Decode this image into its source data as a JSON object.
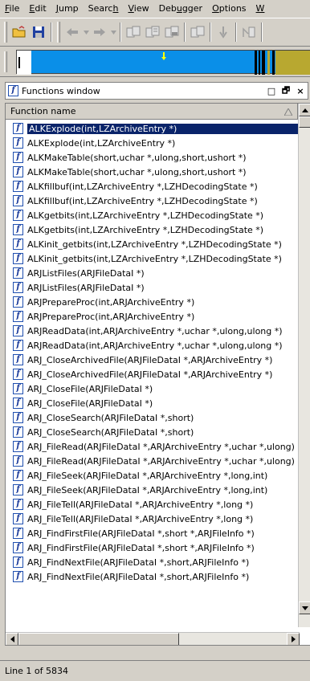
{
  "menu": [
    {
      "label": "File",
      "u": "F",
      "rest": "ile"
    },
    {
      "label": "Edit",
      "u": "E",
      "rest": "dit"
    },
    {
      "label": "Jump",
      "u": "J",
      "rest": "ump"
    },
    {
      "label": "Search",
      "pre": "Searc",
      "u": "h",
      "rest": ""
    },
    {
      "label": "View",
      "u": "V",
      "rest": "iew"
    },
    {
      "label": "Debugger",
      "pre": "Deb",
      "u": "u",
      "rest": "gger"
    },
    {
      "label": "Options",
      "u": "O",
      "rest": "ptions"
    },
    {
      "label": "W",
      "u": "W",
      "rest": ""
    }
  ],
  "panel": {
    "title": "Functions window",
    "icon": "f",
    "buttons": [
      "□",
      "🗗",
      "×"
    ]
  },
  "list": {
    "column_header": "Function name",
    "selected_index": 0,
    "items": [
      "ALKExplode(int,LZArchiveEntry *)",
      "ALKExplode(int,LZArchiveEntry *)",
      "ALKMakeTable(short,uchar *,ulong,short,ushort *)",
      "ALKMakeTable(short,uchar *,ulong,short,ushort *)",
      "ALKfillbuf(int,LZArchiveEntry *,LZHDecodingState *)",
      "ALKfillbuf(int,LZArchiveEntry *,LZHDecodingState *)",
      "ALKgetbits(int,LZArchiveEntry *,LZHDecodingState *)",
      "ALKgetbits(int,LZArchiveEntry *,LZHDecodingState *)",
      "ALKinit_getbits(int,LZArchiveEntry *,LZHDecodingState *)",
      "ALKinit_getbits(int,LZArchiveEntry *,LZHDecodingState *)",
      "ARJListFiles(ARJFileDataI *)",
      "ARJListFiles(ARJFileDataI *)",
      "ARJPrepareProc(int,ARJArchiveEntry *)",
      "ARJPrepareProc(int,ARJArchiveEntry *)",
      "ARJReadData(int,ARJArchiveEntry *,uchar *,ulong,ulong *)",
      "ARJReadData(int,ARJArchiveEntry *,uchar *,ulong,ulong *)",
      "ARJ_CloseArchivedFile(ARJFileDataI *,ARJArchiveEntry *)",
      "ARJ_CloseArchivedFile(ARJFileDataI *,ARJArchiveEntry *)",
      "ARJ_CloseFile(ARJFileDataI *)",
      "ARJ_CloseFile(ARJFileDataI *)",
      "ARJ_CloseSearch(ARJFileDataI *,short)",
      "ARJ_CloseSearch(ARJFileDataI *,short)",
      "ARJ_FileRead(ARJFileDataI *,ARJArchiveEntry *,uchar *,ulong)",
      "ARJ_FileRead(ARJFileDataI *,ARJArchiveEntry *,uchar *,ulong)",
      "ARJ_FileSeek(ARJFileDataI *,ARJArchiveEntry *,long,int)",
      "ARJ_FileSeek(ARJFileDataI *,ARJArchiveEntry *,long,int)",
      "ARJ_FileTell(ARJFileDataI *,ARJArchiveEntry *,long *)",
      "ARJ_FileTell(ARJFileDataI *,ARJArchiveEntry *,long *)",
      "ARJ_FindFirstFile(ARJFileDataI *,short *,ARJFileInfo *)",
      "ARJ_FindFirstFile(ARJFileDataI *,short *,ARJFileInfo *)",
      "ARJ_FindNextFile(ARJFileDataI *,short,ARJFileInfo *)",
      "ARJ_FindNextFile(ARJFileDataI *,short,ARJFileInfo *)"
    ]
  },
  "status": {
    "text": "Line 1 of 5834"
  },
  "colors": {
    "selection": "#0a246a",
    "navigator_code": "#0a8fe8",
    "navigator_data": "#b8a830",
    "chrome": "#d4d0c8"
  }
}
